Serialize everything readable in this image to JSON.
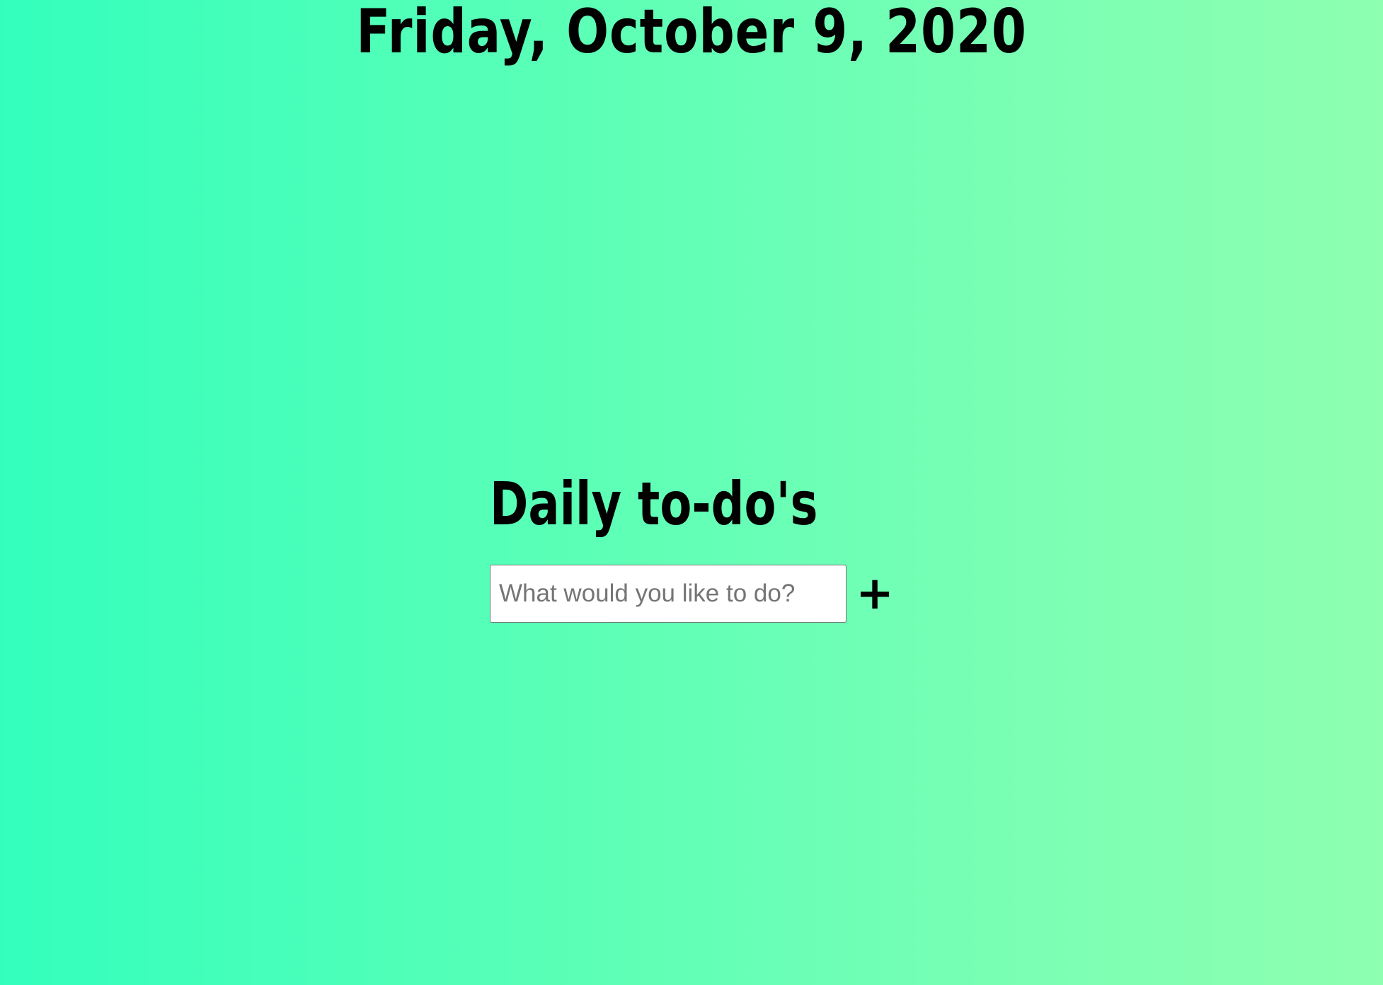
{
  "header": {
    "date": "Friday, October 9, 2020"
  },
  "todo": {
    "title": "Daily to-do's",
    "input_placeholder": "What would you like to do?",
    "input_value": "",
    "add_label": "+"
  },
  "colors": {
    "background_start": "#33ffbd",
    "background_end": "#8effb0",
    "text": "#000000"
  }
}
